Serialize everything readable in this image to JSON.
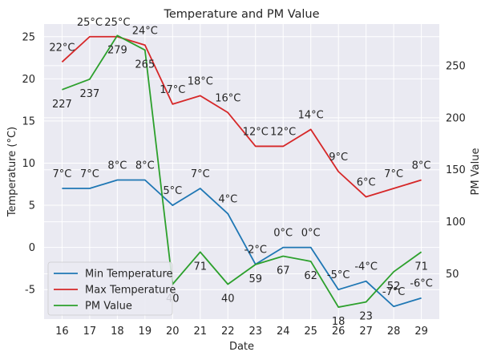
{
  "chart_data": {
    "type": "line",
    "title": "Temperature and PM Value",
    "xlabel": "Date",
    "ylabel_left": "Temperature (°C)",
    "ylabel_right": "PM Value",
    "x": [
      16,
      17,
      18,
      19,
      20,
      21,
      22,
      23,
      24,
      25,
      26,
      27,
      28,
      29
    ],
    "ylim_left": [
      -8.5,
      26.5
    ],
    "ylim_right": [
      6.5,
      290
    ],
    "yticks_left": [
      -5,
      0,
      5,
      10,
      15,
      20,
      25
    ],
    "yticks_right": [
      50,
      100,
      150,
      200,
      250
    ],
    "grid": true,
    "legend_position": "lower-left",
    "series": [
      {
        "name": "Min Temperature",
        "axis": "left",
        "color": "#1f77b4",
        "values": [
          7,
          7,
          8,
          8,
          5,
          7,
          4,
          -2,
          0,
          0,
          -5,
          -4,
          -7,
          -6
        ],
        "labels": [
          "7°C",
          "7°C",
          "8°C",
          "8°C",
          "5°C",
          "7°C",
          "4°C",
          "-2°C",
          "0°C",
          "0°C",
          "-5°C",
          "-4°C",
          "-7°C",
          "-6°C"
        ]
      },
      {
        "name": "Max Temperature",
        "axis": "left",
        "color": "#d62728",
        "values": [
          22,
          25,
          25,
          24,
          17,
          18,
          16,
          12,
          12,
          14,
          9,
          6,
          7,
          8
        ],
        "labels": [
          "22°C",
          "25°C",
          "25°C",
          "24°C",
          "17°C",
          "18°C",
          "16°C",
          "12°C",
          "12°C",
          "14°C",
          "9°C",
          "6°C",
          "7°C",
          "8°C"
        ]
      },
      {
        "name": "PM Value",
        "axis": "right",
        "color": "#2ca02c",
        "values": [
          227,
          237,
          279,
          265,
          40,
          71,
          40,
          59,
          67,
          62,
          18,
          23,
          52,
          71
        ],
        "labels": [
          "227",
          "237",
          "279",
          "265",
          "40",
          "71",
          "40",
          "59",
          "67",
          "62",
          "18",
          "23",
          "52",
          "71"
        ]
      }
    ]
  }
}
